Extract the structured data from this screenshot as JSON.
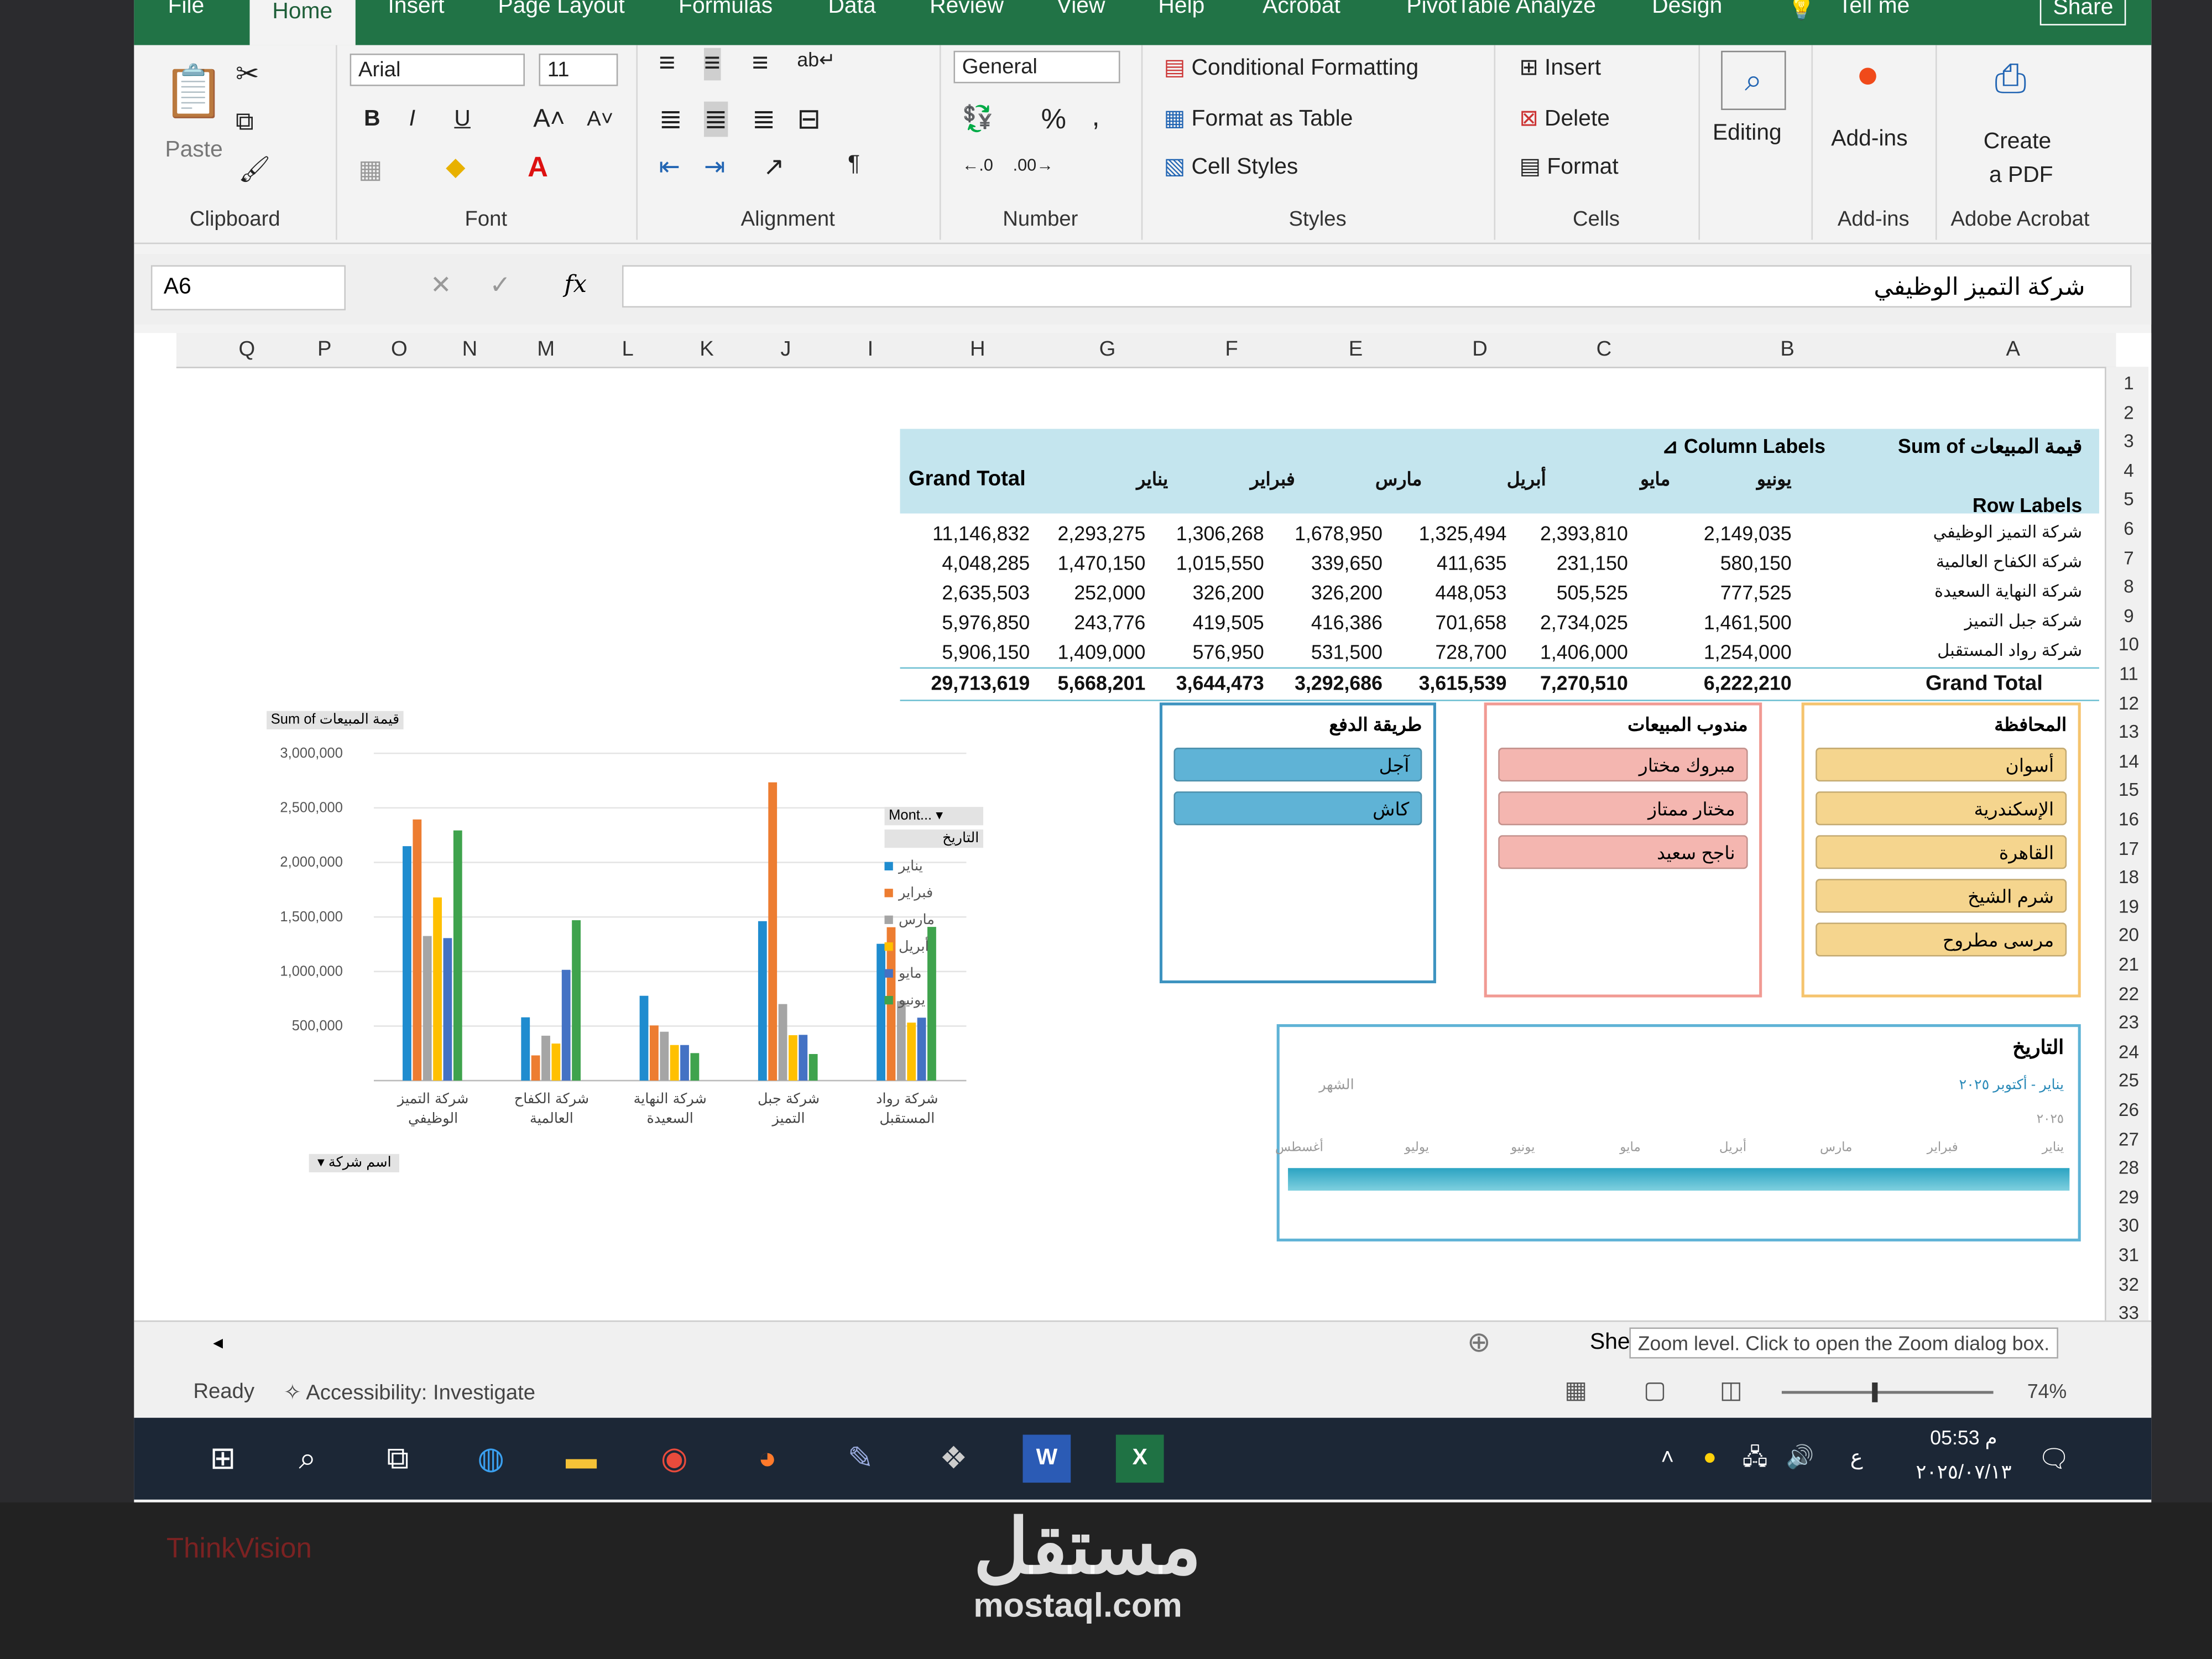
{
  "ribbon": {
    "tabs": [
      "File",
      "Home",
      "Insert",
      "Page Layout",
      "Formulas",
      "Data",
      "Review",
      "View",
      "Help",
      "Acrobat",
      "PivotTable Analyze",
      "Design"
    ],
    "tell_me": "Tell me",
    "share": "Share",
    "clipboard": {
      "paste": "Paste",
      "label": "Clipboard"
    },
    "font": {
      "name": "Arial",
      "size": "11",
      "label": "Font"
    },
    "alignment": {
      "label": "Alignment"
    },
    "number": {
      "format": "General",
      "label": "Number"
    },
    "styles": {
      "conditional": "Conditional Formatting",
      "format_table": "Format as Table",
      "cell_styles": "Cell Styles",
      "label": "Styles"
    },
    "cells": {
      "insert": "Insert",
      "delete": "Delete",
      "format": "Format",
      "label": "Cells"
    },
    "editing": {
      "label": "Editing"
    },
    "addins": {
      "label": "Add-ins",
      "group": "Add-ins"
    },
    "acrobat": {
      "create": "Create",
      "pdf": "a PDF",
      "group": "Adobe Acrobat"
    }
  },
  "formula_bar": {
    "name_box": "A6",
    "fx": "fx",
    "value": "شركة التميز الوظيفي"
  },
  "columns": [
    "Q",
    "P",
    "O",
    "N",
    "M",
    "L",
    "K",
    "J",
    "I",
    "H",
    "G",
    "F",
    "E",
    "D",
    "C",
    "B",
    "A"
  ],
  "rows": [
    "1",
    "2",
    "3",
    "4",
    "5",
    "6",
    "7",
    "8",
    "9",
    "10",
    "11",
    "12",
    "13",
    "14",
    "15",
    "16",
    "17",
    "18",
    "19",
    "20",
    "21",
    "22",
    "23",
    "24",
    "25",
    "26",
    "27",
    "28",
    "29",
    "30",
    "31",
    "32",
    "33"
  ],
  "pivot": {
    "sum_label": "Sum of قيمة المبيعات",
    "column_labels": "Column Labels",
    "row_labels": "Row Labels",
    "months": [
      "يناير",
      "فبراير",
      "مارس",
      "أبريل",
      "مايو",
      "يونيو"
    ],
    "grand_total_header": "Grand Total",
    "rows": [
      {
        "name": "شركة التميز الوظيفي",
        "values": [
          "2,149,035",
          "2,393,810",
          "1,325,494",
          "1,678,950",
          "1,306,268",
          "2,293,275",
          "11,146,832"
        ]
      },
      {
        "name": "شركة الكفاح العالمية",
        "values": [
          "580,150",
          "231,150",
          "411,635",
          "339,650",
          "1,015,550",
          "1,470,150",
          "4,048,285"
        ]
      },
      {
        "name": "شركة النهاية السعيدة",
        "values": [
          "777,525",
          "505,525",
          "448,053",
          "326,200",
          "326,200",
          "252,000",
          "2,635,503"
        ]
      },
      {
        "name": "شركة جبل التميز",
        "values": [
          "1,461,500",
          "2,734,025",
          "701,658",
          "416,386",
          "419,505",
          "243,776",
          "5,976,850"
        ]
      },
      {
        "name": "شركة رواد المستقبل",
        "values": [
          "1,254,000",
          "1,406,000",
          "728,700",
          "531,500",
          "576,950",
          "1,409,000",
          "5,906,150"
        ]
      }
    ],
    "grand_total": {
      "name": "Grand Total",
      "values": [
        "6,222,210",
        "7,270,510",
        "3,615,539",
        "3,292,686",
        "3,644,473",
        "5,668,201",
        "29,713,619"
      ]
    }
  },
  "slicers": {
    "payment": {
      "title": "طريقة الدفع",
      "items": [
        "آجل",
        "كاش"
      ],
      "color": "#5fb3d6"
    },
    "rep": {
      "title": "مندوب المبيعات",
      "items": [
        "مبروك مختار",
        "مختار ممتاز",
        "ناجح سعيد"
      ],
      "color": "#f4b6b0"
    },
    "region": {
      "title": "المحافظة",
      "items": [
        "أسوان",
        "الإسكندرية",
        "القاهرة",
        "شرم الشيخ",
        "مرسى مطروح"
      ],
      "color": "#f5d58e"
    }
  },
  "timeline": {
    "title": "التاريخ",
    "range": "يناير - أكتوبر ٢٠٢٥",
    "level": "الشهر",
    "year": "٢٠٢٥",
    "months": [
      "يناير",
      "فبراير",
      "مارس",
      "أبريل",
      "مايو",
      "يونيو",
      "يوليو",
      "أغسطس"
    ]
  },
  "chart_data": {
    "type": "bar",
    "title": "Sum of قيمة المبيعات",
    "categories": [
      "شركة التميز الوظيفي",
      "شركة الكفاح العالمية",
      "شركة النهاية السعيدة",
      "شركة جبل التميز",
      "شركة رواد المستقبل"
    ],
    "series": [
      {
        "name": "يناير",
        "values": [
          2149035,
          580150,
          777525,
          1461500,
          1254000
        ],
        "color": "#1f8ccf"
      },
      {
        "name": "فبراير",
        "values": [
          2393810,
          231150,
          505525,
          2734025,
          1406000
        ],
        "color": "#ed7d31"
      },
      {
        "name": "مارس",
        "values": [
          1325494,
          411635,
          448053,
          701658,
          728700
        ],
        "color": "#a5a5a5"
      },
      {
        "name": "أبريل",
        "values": [
          1678950,
          339650,
          326200,
          416386,
          531500
        ],
        "color": "#ffc000"
      },
      {
        "name": "مايو",
        "values": [
          1306268,
          1015550,
          326200,
          419505,
          576950
        ],
        "color": "#4472c4"
      },
      {
        "name": "يونيو",
        "values": [
          2293275,
          1470150,
          252000,
          243776,
          1409000
        ],
        "color": "#3fa34d"
      }
    ],
    "ylim": [
      0,
      3000000
    ],
    "yticks": [
      "3,000,000",
      "2,500,000",
      "2,000,000",
      "1,500,000",
      "1,000,000",
      "500,000"
    ],
    "legend_filter_month": "Mont...",
    "legend_filter_date": "التاريخ",
    "axis_field": "اسم شركة",
    "legend_position": "right"
  },
  "status": {
    "ready": "Ready",
    "accessibility": "Accessibility: Investigate",
    "sheet": "She",
    "tooltip": "Zoom level. Click to open the Zoom dialog box.",
    "zoom": "74%"
  },
  "taskbar": {
    "time": "05:53 م",
    "date": "٢٠٢٥/٠٧/١٣",
    "lang": "ع"
  },
  "watermark": {
    "brand": "مستقل",
    "url": "mostaql.com"
  },
  "monitor": "ThinkVision"
}
